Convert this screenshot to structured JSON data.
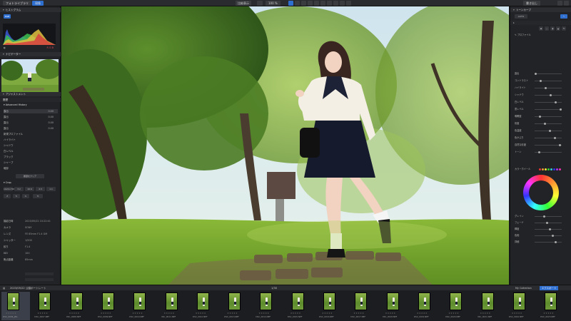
{
  "top": {
    "tabs": [
      "フォトライブラリ",
      "現像"
    ],
    "zoom": "100 %",
    "zoom_mode": "比較表示",
    "export_label": "書き出し"
  },
  "left": {
    "histogram_title": "ヒストグラム",
    "navigator_title": "ナビゲーター",
    "adjust_title": "アジャストメント",
    "history_header": "履歴",
    "history_group": "Advanced History",
    "history_items": [
      {
        "label": "露出",
        "value": "0.00"
      },
      {
        "label": "露出",
        "value": "0.00"
      },
      {
        "label": "露出",
        "value": "0.00"
      },
      {
        "label": "露出",
        "value": "0.00"
      },
      {
        "label": "新規プロファイル",
        "value": ""
      },
      {
        "label": "ハイライト",
        "value": ""
      },
      {
        "label": "シャドウ",
        "value": ""
      },
      {
        "label": "白レベル",
        "value": ""
      },
      {
        "label": "ブラック",
        "value": ""
      },
      {
        "label": "シャープ",
        "value": ""
      },
      {
        "label": "暗部",
        "value": ""
      }
    ],
    "history_button": "履歴をクリア",
    "crop_header": "Crop",
    "crop_buttons": [
      "1024×768",
      "3:2",
      "16:9",
      "4:3",
      "1:1"
    ],
    "info_rows": [
      {
        "label": "撮影日時",
        "value": "2023/05/22 10:22:41"
      },
      {
        "label": "カメラ",
        "value": "SONY"
      },
      {
        "label": "レンズ",
        "value": "FE 85mm F1.4 GM"
      },
      {
        "label": "シャッター",
        "value": "1/500"
      },
      {
        "label": "絞り",
        "value": "F1.4"
      },
      {
        "label": "ISO",
        "value": "100"
      },
      {
        "label": "焦点距離",
        "value": "85mm"
      }
    ]
  },
  "right": {
    "title": "トーンカーブ",
    "profile": "プロファイル",
    "section_color": "カラーホイール",
    "rows": [
      "露出",
      "コントラスト",
      "ハイライト",
      "シャドウ",
      "白レベル",
      "黒レベル",
      "明瞭度",
      "彩度",
      "色温度",
      "色かぶり",
      "自然な彩度",
      "トーン",
      "グレイン",
      "フェード",
      "輝度",
      "色相",
      "詳細"
    ]
  },
  "film": {
    "path": "2023/05/22 公園ポートレート",
    "count": "1/30",
    "collection_label": "My Collection",
    "export_button": "エクスポート",
    "items": [
      {
        "name": "DSC_0006_JPG"
      },
      {
        "name": "DSC_0007.NEF"
      },
      {
        "name": "DSC_0008.NEF"
      },
      {
        "name": "DSC_0009.NEF"
      },
      {
        "name": "DSC_0010.NEF"
      },
      {
        "name": "DSC_0011.NEF"
      },
      {
        "name": "DSC_0012.NEF"
      },
      {
        "name": "DSC_0013.NEF"
      },
      {
        "name": "DSC_0014.NEF"
      },
      {
        "name": "DSC_0015.NEF"
      },
      {
        "name": "DSC_0016.NEF"
      },
      {
        "name": "DSC_0017.NEF"
      },
      {
        "name": "DSC_0018.NEF"
      },
      {
        "name": "DSC_0019.NEF"
      },
      {
        "name": "DSC_0020.NEF"
      },
      {
        "name": "DSC_0021.NEF"
      },
      {
        "name": "DSC_0022.NEF"
      },
      {
        "name": "DSC_0023.NEF"
      }
    ]
  },
  "colors": {
    "accent": "#2f6fd0",
    "panel": "#222326"
  }
}
